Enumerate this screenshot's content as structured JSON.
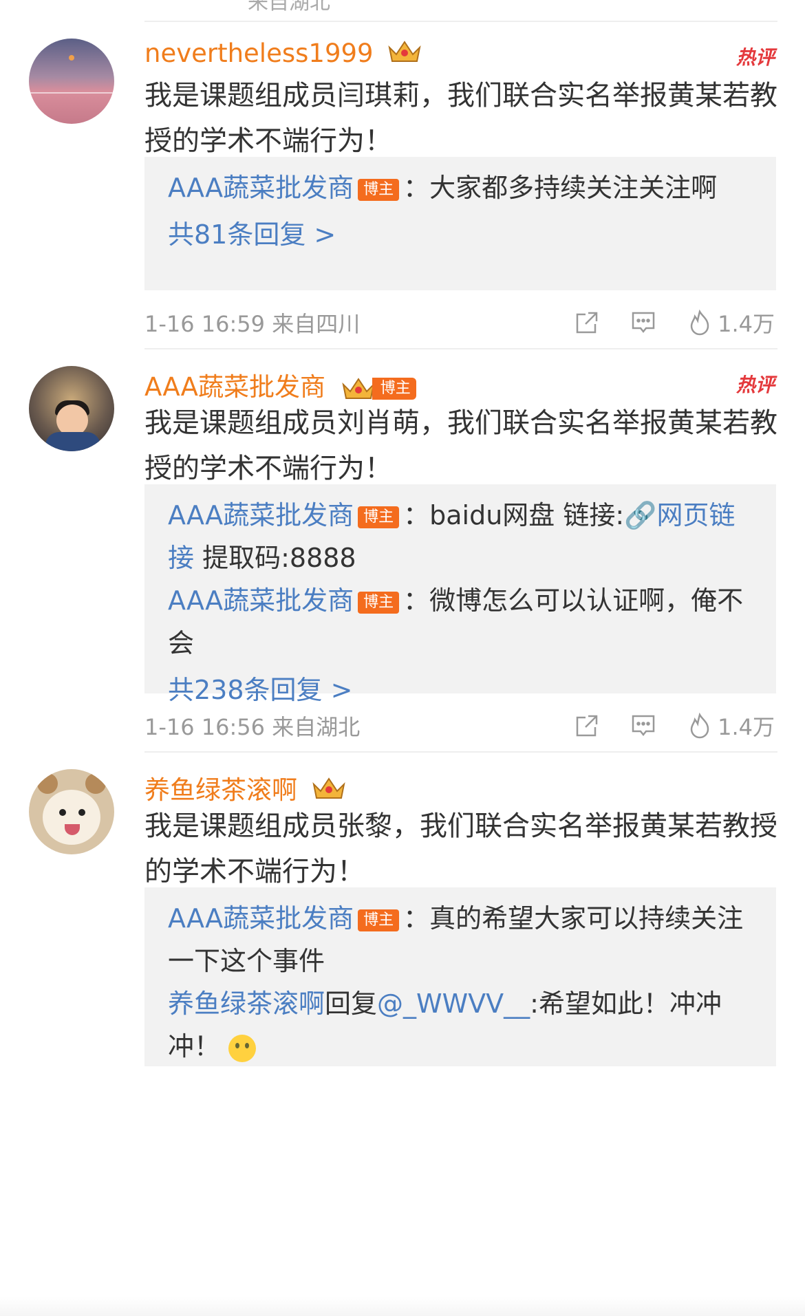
{
  "top_strip": {
    "text_fragment": "来自湖北"
  },
  "comments": [
    {
      "username": "nevertheless1999",
      "hot_label": "热评",
      "text": "我是课题组成员闫琪莉，我们联合实名举报黄某若教授的学术不端行为！",
      "replies": [
        {
          "name": "AAA蔬菜批发商",
          "badge": "博主",
          "sep": "：",
          "text": "大家都多持续关注关注啊"
        }
      ],
      "more_replies": "共81条回复 >",
      "time": "1-16 16:59  来自四川",
      "likes": "1.4万"
    },
    {
      "username": "AAA蔬菜批发商",
      "user_badge": "博主",
      "hot_label": "热评",
      "text": "我是课题组成员刘肖萌，我们联合实名举报黄某若教授的学术不端行为！",
      "replies": [
        {
          "name": "AAA蔬菜批发商",
          "badge": "博主",
          "sep": "：",
          "text_before": "baidu网盘 链接:",
          "link": "网页链接",
          "text_after": "  提取码:8888"
        },
        {
          "name": "AAA蔬菜批发商",
          "badge": "博主",
          "sep": "：",
          "text": "微博怎么可以认证啊，俺不会"
        }
      ],
      "more_replies": "共238条回复 >",
      "time": "1-16 16:56  来自湖北",
      "likes": "1.4万"
    },
    {
      "username": "养鱼绿茶滚啊",
      "text": "我是课题组成员张黎，我们联合实名举报黄某若教授的学术不端行为！",
      "replies": [
        {
          "name": "AAA蔬菜批发商",
          "badge": "博主",
          "sep": "：",
          "text": "真的希望大家可以持续关注一下这个事件"
        },
        {
          "name": "养鱼绿茶滚啊",
          "reply_word": "回复",
          "mention": "@_WWVV__",
          "text": ":希望如此！冲冲冲！"
        }
      ]
    }
  ],
  "colors": {
    "username": "#f07d1c",
    "link": "#4b7ec2",
    "badge": "#f46c1e",
    "hot": "#e4393c",
    "reply_bg": "#f2f2f2",
    "meta": "#999999"
  }
}
